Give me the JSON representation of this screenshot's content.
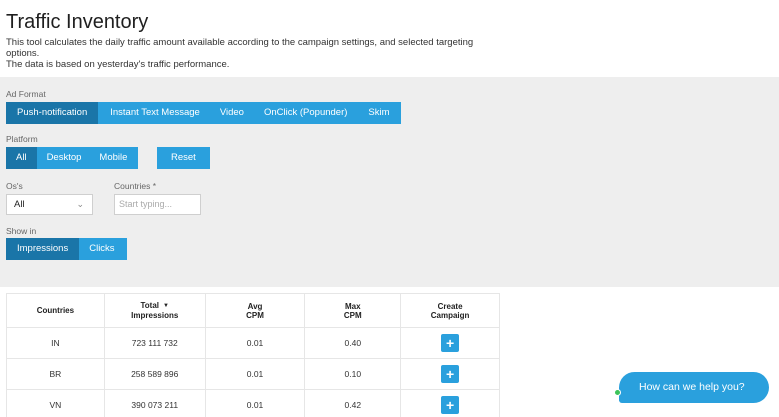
{
  "header": {
    "title": "Traffic Inventory",
    "description_line1": "This tool calculates the daily traffic amount available according to the campaign settings, and selected targeting options.",
    "description_line2": "The data is based on yesterday's traffic performance."
  },
  "ad_format": {
    "label": "Ad Format",
    "options": [
      "Push-notification",
      "Instant Text Message",
      "Video",
      "OnClick (Popunder)",
      "Skim"
    ],
    "selected": "Push-notification"
  },
  "platform": {
    "label": "Platform",
    "options": [
      "All",
      "Desktop",
      "Mobile"
    ],
    "selected": "All",
    "reset_label": "Reset"
  },
  "os": {
    "label": "Os's",
    "value": "All"
  },
  "countries": {
    "label": "Countries *",
    "placeholder": "Start typing..."
  },
  "show_in": {
    "label": "Show in",
    "options": [
      "Impressions",
      "Clicks"
    ],
    "selected": "Impressions"
  },
  "table": {
    "headers": {
      "countries": "Countries",
      "total_impressions_1": "Total",
      "total_impressions_2": "Impressions",
      "avg_cpm_1": "Avg",
      "avg_cpm_2": "CPM",
      "max_cpm_1": "Max",
      "max_cpm_2": "CPM",
      "create_1": "Create",
      "create_2": "Campaign"
    },
    "sort_icon": "caret-down-icon",
    "rows": [
      {
        "country": "IN",
        "impressions": "723 111 732",
        "avg_cpm": "0.01",
        "max_cpm": "0.40"
      },
      {
        "country": "BR",
        "impressions": "258 589 896",
        "avg_cpm": "0.01",
        "max_cpm": "0.10"
      },
      {
        "country": "VN",
        "impressions": "390 073 211",
        "avg_cpm": "0.01",
        "max_cpm": "0.42"
      }
    ],
    "add_symbol": "+"
  },
  "chat": {
    "label": "How can we help you?"
  },
  "colors": {
    "accent": "#2aa0dd",
    "accent_active": "#1a75a8",
    "panel_bg": "#eeeeee",
    "online": "#3cc35a"
  }
}
